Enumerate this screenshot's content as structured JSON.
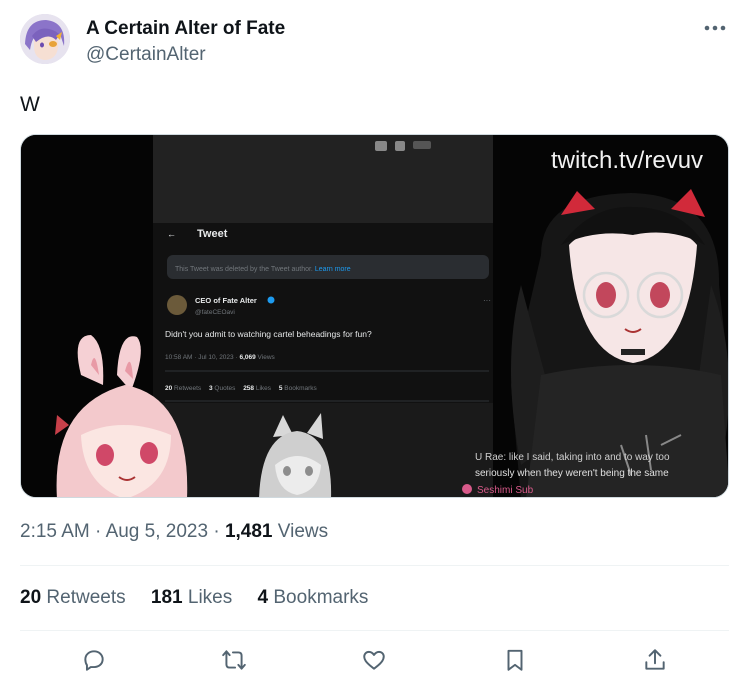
{
  "author": {
    "display_name": "A Certain Alter of Fate",
    "handle": "@CertainAlter",
    "avatar_icon": "avatar-anime-purple-hair"
  },
  "tweet": {
    "text": "W"
  },
  "media": {
    "overlay_url_text": "twitch.tv/revuv",
    "embedded_tweet": {
      "header": "Tweet",
      "deleted_notice": "This Tweet was deleted by the Tweet author.",
      "deleted_link": "Learn more",
      "name": "CEO of Fate Alter",
      "handle": "@fateCEOavi",
      "text": "Didn't you admit to watching cartel beheadings for fun?",
      "time": "10:58 AM · Jul 10, 2023 ·",
      "views_count": "6,069",
      "views_label": "Views",
      "stats": [
        {
          "count": "20",
          "label": "Retweets"
        },
        {
          "count": "3",
          "label": "Quotes"
        },
        {
          "count": "258",
          "label": "Likes"
        },
        {
          "count": "5",
          "label": "Bookmarks"
        }
      ]
    },
    "chat_line_1": "U Rae: like I said, taking into and to way too",
    "chat_line_2": "seriously when they weren't being the same",
    "chat_user": "Seshimi Sub"
  },
  "meta": {
    "time": "2:15 AM",
    "sep1": " · ",
    "date": "Aug 5, 2023",
    "sep2": " · ",
    "views_count": "1,481",
    "views_label": " Views"
  },
  "stats": {
    "retweets_count": "20",
    "retweets_label": " Retweets",
    "likes_count": "181",
    "likes_label": " Likes",
    "bookmarks_count": "4",
    "bookmarks_label": " Bookmarks"
  },
  "actions": [
    "reply-icon",
    "retweet-icon",
    "like-icon",
    "bookmark-icon",
    "share-icon"
  ],
  "colors": {
    "text_primary": "#0f1419",
    "text_secondary": "#536471",
    "divider": "#eff3f4",
    "link_blue": "#1d9bf0"
  }
}
